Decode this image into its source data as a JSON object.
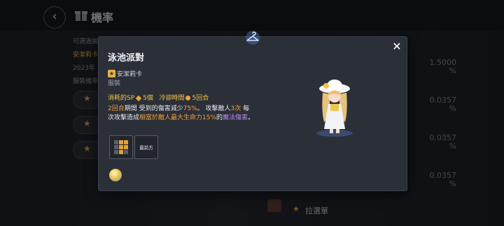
{
  "background": {
    "title": "機率",
    "left_lines": [
      {
        "text": "可選過抽",
        "accent": false
      },
      {
        "text": "安潔莉卡",
        "accent": true
      },
      {
        "text": "2023年",
        "accent": false
      },
      {
        "text": "服裝機率",
        "accent": false
      }
    ],
    "percentages": [
      "1.5000\n%",
      "0.0357\n%",
      "0.0357\n%",
      "0.0357\n%"
    ],
    "bottom_item": "拉選單"
  },
  "dialog": {
    "title": "泳池派對",
    "character": "安潔莉卡",
    "type": "服裝",
    "stats": {
      "sp_label": "消耗的SP",
      "sp_value": "5個",
      "cooldown_label": "冷卻時間",
      "cooldown_value": "5回合"
    },
    "description": {
      "turns": "2回合",
      "part1": "期間 受到的傷害減少",
      "reduce": "75%",
      "part2": "。 攻擊敵人",
      "hits": "3次",
      "part3": " 每次攻擊造成",
      "dmg": "相當於敵人最大生命力15%",
      "part4": "的",
      "magic": "魔法傷害",
      "part5": "。"
    },
    "range_label": "最前方",
    "colors": {
      "orange": "#f0a23a",
      "yellow": "#f0c34a",
      "purple": "#b98af0"
    }
  },
  "icons": [
    "back-arrow-icon",
    "gift-icon",
    "hanger-icon",
    "close-icon",
    "star-icon",
    "orb-icon"
  ]
}
